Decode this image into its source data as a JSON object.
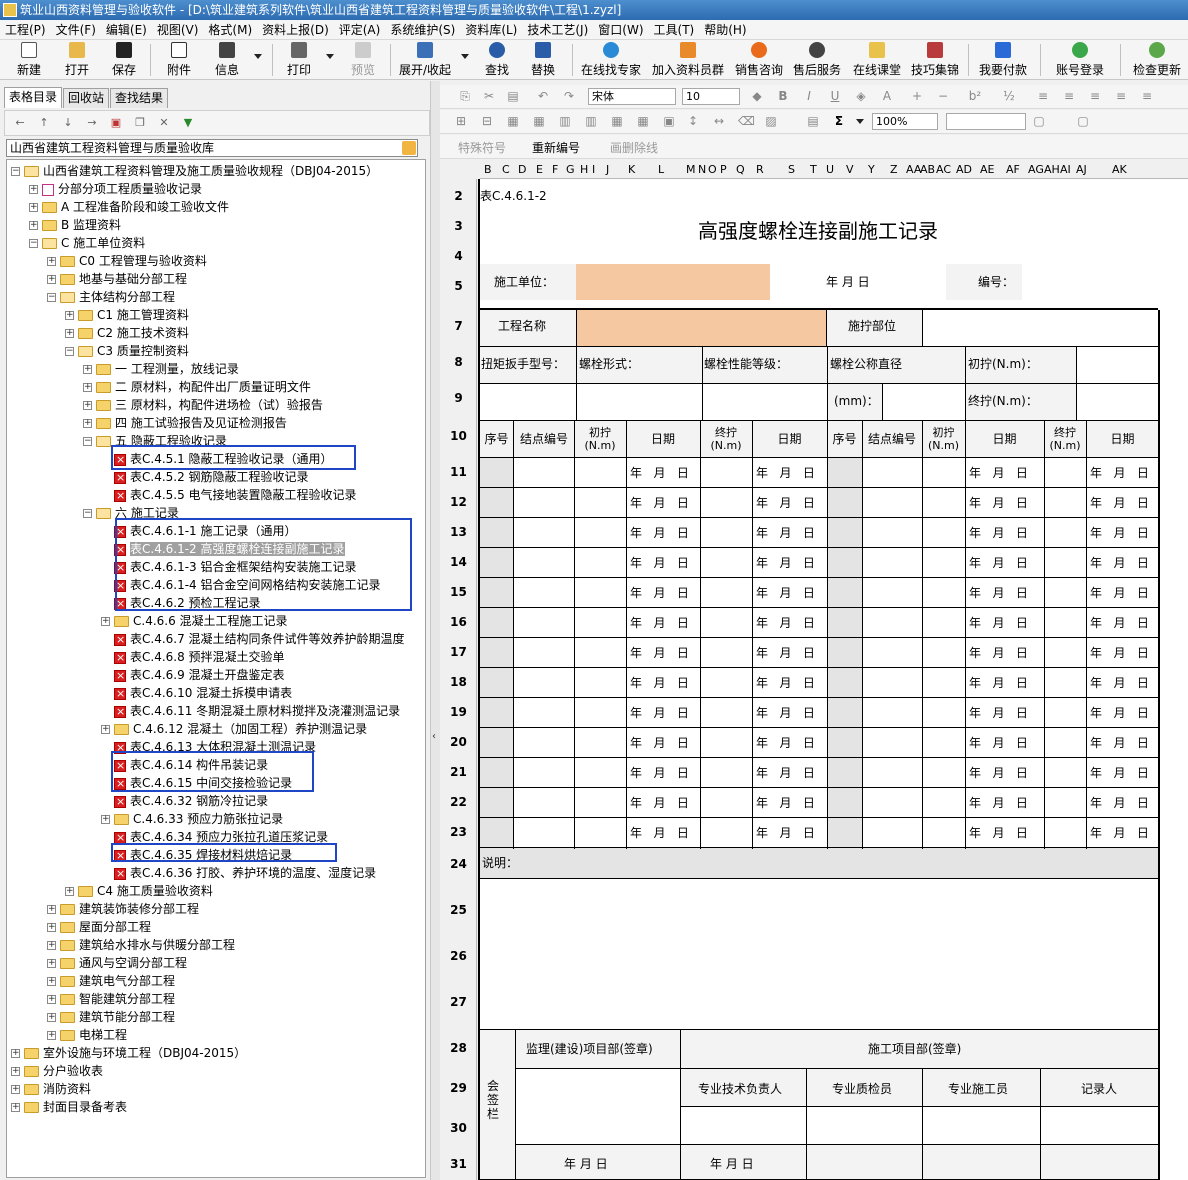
{
  "window": {
    "title": "筑业山西资料管理与验收软件 - [D:\\筑业建筑系列软件\\筑业山西省建筑工程资料管理与质量验收软件\\工程\\1.zyzl]"
  },
  "menu": [
    "工程(P)",
    "文件(F)",
    "编辑(E)",
    "视图(V)",
    "格式(M)",
    "资料上报(D)",
    "评定(A)",
    "系统维护(S)",
    "资料库(L)",
    "技术工艺(J)",
    "窗口(W)",
    "工具(T)",
    "帮助(H)"
  ],
  "toolbar": {
    "new": "新建",
    "open": "打开",
    "save": "保存",
    "attach": "附件",
    "info": "信息",
    "print": "打印",
    "preview": "预览",
    "expand": "展开/收起",
    "find": "查找",
    "replace": "替换",
    "online_expert": "在线找专家",
    "join_group": "加入资料员群",
    "sales": "销售咨询",
    "after_sales": "售后服务",
    "online_class": "在线课堂",
    "tips": "技巧集锦",
    "pay": "我要付款",
    "login": "账号登录",
    "update": "检查更新"
  },
  "left_tabs": [
    "表格目录",
    "回收站",
    "查找结果"
  ],
  "library_combo": "山西省建筑工程资料管理与质量验收库",
  "tree": [
    {
      "label": "山西省建筑工程资料管理及施工质量验收规程（DBJ04-2015）"
    },
    {
      "label": "分部分项工程质量验收记录"
    },
    {
      "label": "A 工程准备阶段和竣工验收文件"
    },
    {
      "label": "B 监理资料"
    },
    {
      "label": "C 施工单位资料"
    },
    {
      "label": "C0 工程管理与验收资料"
    },
    {
      "label": "地基与基础分部工程"
    },
    {
      "label": "主体结构分部工程"
    },
    {
      "label": "C1 施工管理资料"
    },
    {
      "label": "C2 施工技术资料"
    },
    {
      "label": "C3 质量控制资料"
    },
    {
      "label": "一 工程测量，放线记录"
    },
    {
      "label": "二 原材料，构配件出厂质量证明文件"
    },
    {
      "label": "三 原材料，构配件进场检（试）验报告"
    },
    {
      "label": "四 施工试验报告及见证检测报告"
    },
    {
      "label": "五 隐蔽工程验收记录"
    },
    {
      "label": "表C.4.5.1 隐蔽工程验收记录（通用）"
    },
    {
      "label": "表C.4.5.2 钢筋隐蔽工程验收记录"
    },
    {
      "label": "表C.4.5.5 电气接地装置隐蔽工程验收记录"
    },
    {
      "label": "六 施工记录"
    },
    {
      "label": "表C.4.6.1-1 施工记录（通用）"
    },
    {
      "label": "表C.4.6.1-2 高强度螺栓连接副施工记录"
    },
    {
      "label": "表C.4.6.1-3 铝合金框架结构安装施工记录"
    },
    {
      "label": "表C.4.6.1-4 铝合金空间网格结构安装施工记录"
    },
    {
      "label": "表C.4.6.2 预检工程记录"
    },
    {
      "label": "C.4.6.6 混凝土工程施工记录"
    },
    {
      "label": "表C.4.6.7 混凝土结构同条件试件等效养护龄期温度"
    },
    {
      "label": "表C.4.6.8 预拌混凝土交验单"
    },
    {
      "label": "表C.4.6.9 混凝土开盘鉴定表"
    },
    {
      "label": "表C.4.6.10 混凝土拆模申请表"
    },
    {
      "label": "表C.4.6.11 冬期混凝土原材料搅拌及浇灌测温记录"
    },
    {
      "label": "C.4.6.12 混凝土（加固工程）养护测温记录"
    },
    {
      "label": "表C.4.6.13 大体积混凝土测温记录"
    },
    {
      "label": "表C.4.6.14 构件吊装记录"
    },
    {
      "label": "表C.4.6.15 中间交接检验记录"
    },
    {
      "label": "表C.4.6.32 钢筋冷拉记录"
    },
    {
      "label": "C.4.6.33 预应力筋张拉记录"
    },
    {
      "label": "表C.4.6.34 预应力张拉孔道压浆记录"
    },
    {
      "label": "表C.4.6.35 焊接材料烘焙记录"
    },
    {
      "label": "表C.4.6.36 打胶、养护环境的温度、湿度记录"
    },
    {
      "label": "C4 施工质量验收资料"
    },
    {
      "label": "建筑装饰装修分部工程"
    },
    {
      "label": "屋面分部工程"
    },
    {
      "label": "建筑给水排水与供暖分部工程"
    },
    {
      "label": "通风与空调分部工程"
    },
    {
      "label": "建筑电气分部工程"
    },
    {
      "label": "智能建筑分部工程"
    },
    {
      "label": "建筑节能分部工程"
    },
    {
      "label": "电梯工程"
    },
    {
      "label": "室外设施与环境工程（DBJ04-2015）"
    },
    {
      "label": "分户验收表"
    },
    {
      "label": "消防资料"
    },
    {
      "label": "封面目录备考表"
    }
  ],
  "format": {
    "font": "宋体",
    "size": "10",
    "zoom": "100%",
    "sigma": "Σ"
  },
  "special": {
    "symbol": "特殊符号",
    "renumber": "重新编号",
    "strike": "画删除线"
  },
  "columns": [
    "B",
    "C",
    "D",
    "E",
    "F",
    "G",
    "H",
    "I",
    "J",
    "K",
    "L",
    "M",
    "N",
    "O",
    "P",
    "Q",
    "R",
    "S",
    "T",
    "U",
    "V",
    "Y",
    "Z",
    "AA",
    "AB",
    "AC",
    "AD",
    "AE",
    "AF",
    "AG",
    "AH",
    "AI",
    "AJ",
    "AK"
  ],
  "rows": [
    "2",
    "3",
    "4",
    "5",
    "7",
    "8",
    "9",
    "10",
    "11",
    "12",
    "13",
    "14",
    "15",
    "16",
    "17",
    "18",
    "19",
    "20",
    "21",
    "22",
    "23",
    "24",
    "25",
    "26",
    "27",
    "28",
    "29",
    "30",
    "31"
  ],
  "form": {
    "code": "表C.4.6.1-2",
    "title": "高强度螺栓连接副施工记录",
    "unit_label": "施工单位：",
    "date_top": "年  月  日",
    "no_label": "编号：",
    "project_label": "工程名称",
    "part_label": "施拧部位",
    "wrench_label": "扭矩扳手型号：",
    "bolt_form_label": "螺栓形式：",
    "bolt_grade_label": "螺栓性能等级：",
    "bolt_dia_label": "螺栓公称直径",
    "mm_label": "(mm)：",
    "initial_label": "初拧(N.m)：",
    "final_label": "终拧(N.m)：",
    "headers": [
      "序号",
      "结点编号",
      "初拧 (N.m)",
      "日期",
      "终拧 (N.m)",
      "日期",
      "序号",
      "结点编号",
      "初拧 (N.m)",
      "日期",
      "终拧 (N.m)",
      "日期"
    ],
    "date_cell": "年   月   日",
    "note_label": "说明：",
    "sign_vertical": "会签栏",
    "supervisor_label": "监理(建设)项目部(签章)",
    "construction_label": "施工项目部(签章)",
    "tech_label": "专业技术负责人",
    "quality_label": "专业质检员",
    "worker_label": "专业施工员",
    "recorder_label": "记录人",
    "sign_date": "年  月  日"
  },
  "colors": {
    "accent_cell": "#f5c8a2",
    "highlight_box": "#2046c8",
    "title_bar": "#3a7bc0"
  }
}
